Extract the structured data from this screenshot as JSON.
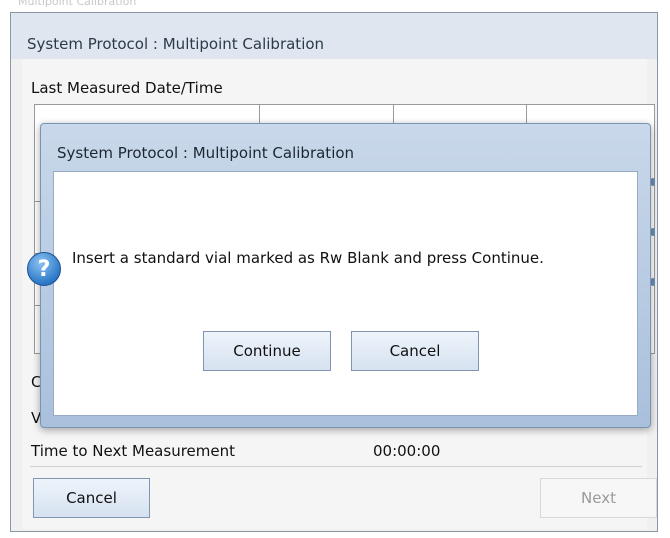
{
  "top_strip": {
    "text": "Multipoint Calibration"
  },
  "window": {
    "title": "System Protocol : Multipoint Calibration"
  },
  "main": {
    "last_measured_label": "Last Measured Date/Time",
    "row_c_prefix": "C",
    "row_v_prefix": "V",
    "time_to_next_label": "Time to Next Measurement",
    "time_to_next_value": "00:00:00",
    "cancel_label": "Cancel",
    "next_label": "Next"
  },
  "dialog": {
    "title": "System Protocol : Multipoint Calibration",
    "icon": "question-icon",
    "message": "Insert a standard vial marked as Rw Blank and press Continue.",
    "continue_label": "Continue",
    "cancel_label": "Cancel"
  }
}
